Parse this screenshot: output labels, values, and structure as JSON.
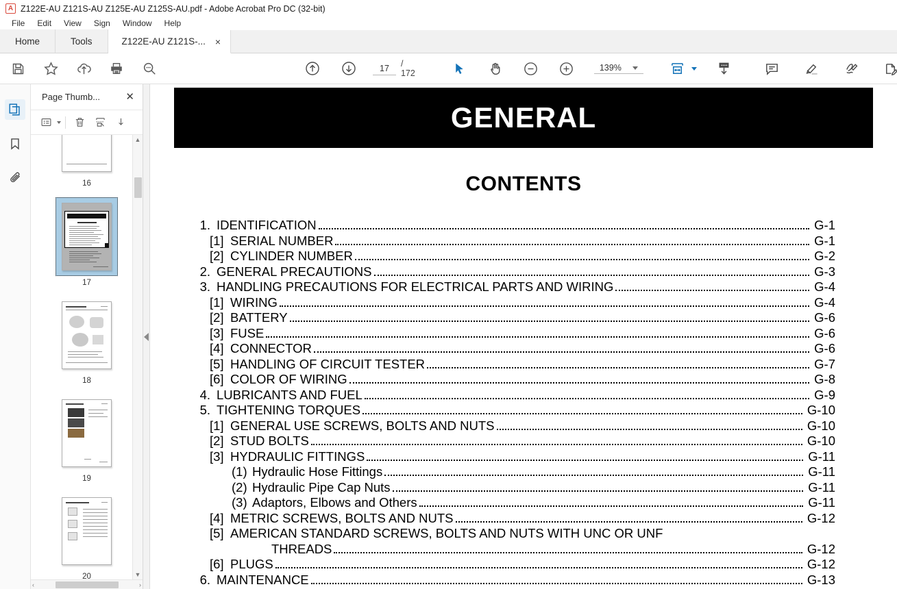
{
  "window": {
    "title": "Z122E-AU Z121S-AU Z125E-AU Z125S-AU.pdf - Adobe Acrobat Pro DC (32-bit)",
    "app_icon": "pdf-icon"
  },
  "menubar": [
    "File",
    "Edit",
    "View",
    "Sign",
    "Window",
    "Help"
  ],
  "tabs": {
    "home": "Home",
    "tools": "Tools",
    "document": "Z122E-AU Z121S-...",
    "close": "×"
  },
  "toolbar": {
    "save": "save-icon",
    "star": "star-icon",
    "cloud": "cloud-upload-icon",
    "print": "print-icon",
    "search": "search-icon",
    "prev_page": "arrow-up-circle-icon",
    "next_page": "arrow-down-circle-icon",
    "page_current": "17",
    "page_total": "/ 172",
    "select_tool": "cursor-arrow-icon",
    "hand_tool": "hand-icon",
    "zoom_out": "minus-circle-icon",
    "zoom_in": "plus-circle-icon",
    "zoom_level": "139%",
    "fit_page": "fit-page-icon",
    "scroll_mode": "scroll-mode-icon",
    "comment": "comment-icon",
    "highlight": "highlight-icon",
    "sign": "sign-icon",
    "fill_sign": "fill-and-sign-icon",
    "accent_color": "#1473b8"
  },
  "rail": [
    {
      "name": "page-thumbnails",
      "icon": "pages-icon",
      "active": true
    },
    {
      "name": "bookmarks",
      "icon": "bookmark-icon",
      "active": false
    },
    {
      "name": "attachments",
      "icon": "paperclip-icon",
      "active": false
    }
  ],
  "thumbnail_panel": {
    "title": "Page Thumb...",
    "close": "✕",
    "tools": [
      "options-list-icon",
      "delete-icon",
      "extract-pages-icon",
      "insert-pages-icon"
    ],
    "pages": [
      {
        "number": "16",
        "selected": false,
        "kind": "blank"
      },
      {
        "number": "17",
        "selected": true,
        "kind": "contents"
      },
      {
        "number": "18",
        "selected": false,
        "kind": "diagram"
      },
      {
        "number": "19",
        "selected": false,
        "kind": "photo"
      },
      {
        "number": "20",
        "selected": false,
        "kind": "table"
      }
    ],
    "scroll_up": "▲",
    "scroll_down": "▼",
    "scroll_left": "‹",
    "scroll_right": "›",
    "collapse": "collapse-panel-arrow"
  },
  "document": {
    "banner": "GENERAL",
    "contents_title": "CONTENTS",
    "toc": [
      {
        "level": 1,
        "num": "1.",
        "label": "IDENTIFICATION",
        "page": "G-1"
      },
      {
        "level": 2,
        "num": "[1]",
        "label": "SERIAL NUMBER",
        "page": "G-1"
      },
      {
        "level": 2,
        "num": "[2]",
        "label": "CYLINDER NUMBER",
        "page": "G-2"
      },
      {
        "level": 1,
        "num": "2.",
        "label": "GENERAL PRECAUTIONS",
        "page": "G-3"
      },
      {
        "level": 1,
        "num": "3.",
        "label": "HANDLING PRECAUTIONS FOR ELECTRICAL PARTS AND WIRING",
        "page": "G-4"
      },
      {
        "level": 2,
        "num": "[1]",
        "label": "WIRING",
        "page": "G-4"
      },
      {
        "level": 2,
        "num": "[2]",
        "label": "BATTERY",
        "page": "G-6"
      },
      {
        "level": 2,
        "num": "[3]",
        "label": "FUSE",
        "page": "G-6"
      },
      {
        "level": 2,
        "num": "[4]",
        "label": "CONNECTOR",
        "page": "G-6"
      },
      {
        "level": 2,
        "num": "[5]",
        "label": "HANDLING OF CIRCUIT TESTER",
        "page": "G-7"
      },
      {
        "level": 2,
        "num": "[6]",
        "label": "COLOR OF WIRING",
        "page": "G-8"
      },
      {
        "level": 1,
        "num": "4.",
        "label": "LUBRICANTS AND FUEL",
        "page": "G-9"
      },
      {
        "level": 1,
        "num": "5.",
        "label": "TIGHTENING TORQUES",
        "page": "G-10"
      },
      {
        "level": 2,
        "num": "[1]",
        "label": "GENERAL USE SCREWS, BOLTS AND NUTS",
        "page": "G-10"
      },
      {
        "level": 2,
        "num": "[2]",
        "label": "STUD BOLTS",
        "page": "G-10"
      },
      {
        "level": 2,
        "num": "[3]",
        "label": "HYDRAULIC FITTINGS",
        "page": "G-11"
      },
      {
        "level": 3,
        "num": "(1)",
        "label": "Hydraulic Hose Fittings",
        "page": "G-11"
      },
      {
        "level": 3,
        "num": "(2)",
        "label": "Hydraulic Pipe Cap Nuts",
        "page": "G-11"
      },
      {
        "level": 3,
        "num": "(3)",
        "label": "Adaptors, Elbows and Others",
        "page": "G-11"
      },
      {
        "level": 2,
        "num": "[4]",
        "label": "METRIC SCREWS, BOLTS AND NUTS",
        "page": "G-12"
      },
      {
        "level": 2,
        "num": "[5]",
        "label": "AMERICAN STANDARD SCREWS, BOLTS AND NUTS WITH UNC OR UNF",
        "page": "",
        "nodots": true
      },
      {
        "level": 9,
        "num": "",
        "label": "THREADS",
        "page": "G-12"
      },
      {
        "level": 2,
        "num": "[6]",
        "label": "PLUGS",
        "page": "G-12"
      },
      {
        "level": 1,
        "num": "6.",
        "label": "MAINTENANCE",
        "page": "G-13"
      }
    ]
  }
}
